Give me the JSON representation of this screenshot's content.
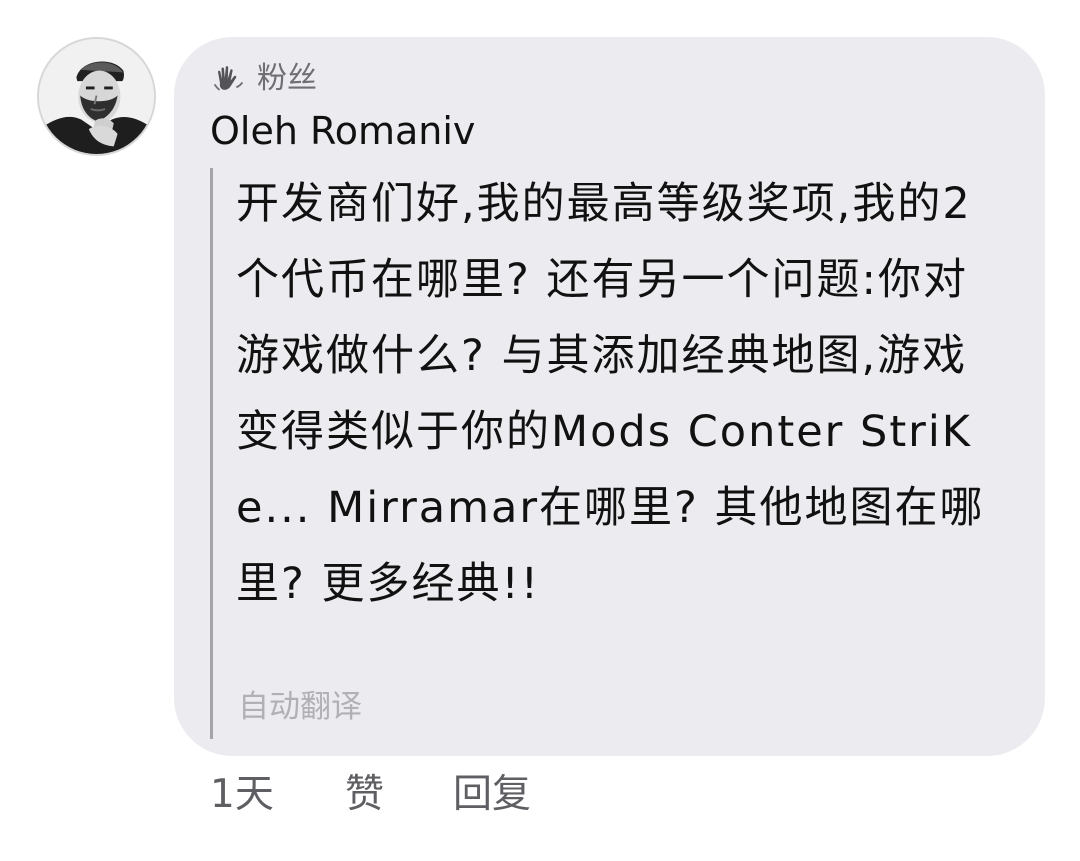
{
  "comment": {
    "fan_label": "粉丝",
    "author_name": "Oleh Romaniv",
    "message": "开发商们好,我的最高等级奖项,我的2个代币在哪里? 还有另一个问题:你对游戏做什么? 与其添加经典地图,游戏变得类似于你的Mods Conter StriKe... Mirramar在哪里? 其他地图在哪里? 更多经典!!",
    "auto_translate": "自动翻译",
    "time": "1天",
    "like_label": "赞",
    "reply_label": "回复"
  },
  "icons": {
    "avatar": "profile-photo-avatar",
    "fan_icon": "waving-hand-icon"
  },
  "colors": {
    "bubble_background": "#ececf0",
    "quote_line": "#a5a5a9",
    "secondary_text": "#6f6f73",
    "muted_text": "#b1b1b5"
  }
}
